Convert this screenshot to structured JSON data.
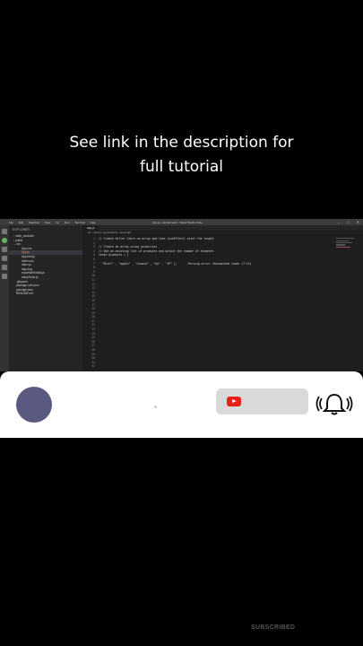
{
  "caption": {
    "line1": "See link in the description for",
    "line2": "full tutorial"
  },
  "vscode": {
    "menu": [
      "File",
      "Edit",
      "Selection",
      "View",
      "Go",
      "Run",
      "Terminal",
      "Help"
    ],
    "window_title": "App.js - tutorial-react - Visual Studio Code",
    "explorer_header": "EXPLORER",
    "tab_label": "App.js",
    "breadcrumb": "src › App.js › [e] products › [e] lenght",
    "tree": [
      {
        "label": "› node_modules",
        "type": "folder"
      },
      {
        "label": "› public",
        "type": "folder"
      },
      {
        "label": "⌄ src",
        "type": "folder"
      },
      {
        "label": "App.css",
        "type": "file"
      },
      {
        "label": "App.js",
        "type": "error"
      },
      {
        "label": "App.test.js",
        "type": "file"
      },
      {
        "label": "index.css",
        "type": "file"
      },
      {
        "label": "index.js",
        "type": "file"
      },
      {
        "label": "logo.svg",
        "type": "file"
      },
      {
        "label": "reportWebVitals.js",
        "type": "file"
      },
      {
        "label": "setupTests.js",
        "type": "file"
      },
      {
        "label": ".gitignore",
        "type": "root"
      },
      {
        "label": "package-lock.json",
        "type": "root"
      },
      {
        "label": "package.json",
        "type": "root"
      },
      {
        "label": "README.md",
        "type": "root"
      }
    ],
    "code": {
      "line1": "// Create Seller Store an array and then (useEffect) print the length",
      "line2": "// Create an array using javascript",
      "line3": "// Use an existing list of products and output the number of elements",
      "line4": "const products = [",
      "line5": "  \"Shirt\" , \"apple\" , \"Lenovo\" , \"hp\" , \"IP\" ];",
      "error_hint": "Parsing error: Unexpected token (7:13)"
    }
  },
  "popup": {
    "icons": [
      "youtube-icon",
      "bell-ringing-icon"
    ]
  },
  "watermark": "SUBSCRIBED"
}
